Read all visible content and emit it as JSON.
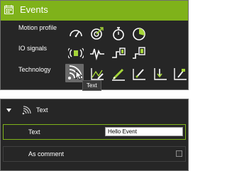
{
  "events_panel": {
    "title": "Events",
    "header_icon": "calendar-icon",
    "rows": [
      {
        "label": "Motion profile",
        "icons": [
          "speedometer-icon",
          "target-icon",
          "stopwatch-icon",
          "timer-icon"
        ]
      },
      {
        "label": "IO signals",
        "icons": [
          "io-signal-icon",
          "waveform-icon",
          "edge-rise-icon",
          "edge-flag-icon"
        ]
      },
      {
        "label": "Technology",
        "icons": [
          "text-event-icon",
          "technology-plot-icon",
          "pen-icon",
          "marker-icon",
          "graph-down-icon",
          "flag-plot-icon"
        ]
      }
    ],
    "selected_icon": "text-event-icon",
    "tooltip": "Text"
  },
  "properties_panel": {
    "header_label": "Text",
    "header_icon": "text-event-icon",
    "text_row": {
      "label": "Text",
      "value": "Hello Event"
    },
    "comment_row": {
      "label": "As comment",
      "checked": false
    }
  },
  "colors": {
    "accent": "#7fb21a",
    "panel_bg": "#262626",
    "icon_fg": "#ffffff",
    "icon_accent": "#a6d63a"
  }
}
